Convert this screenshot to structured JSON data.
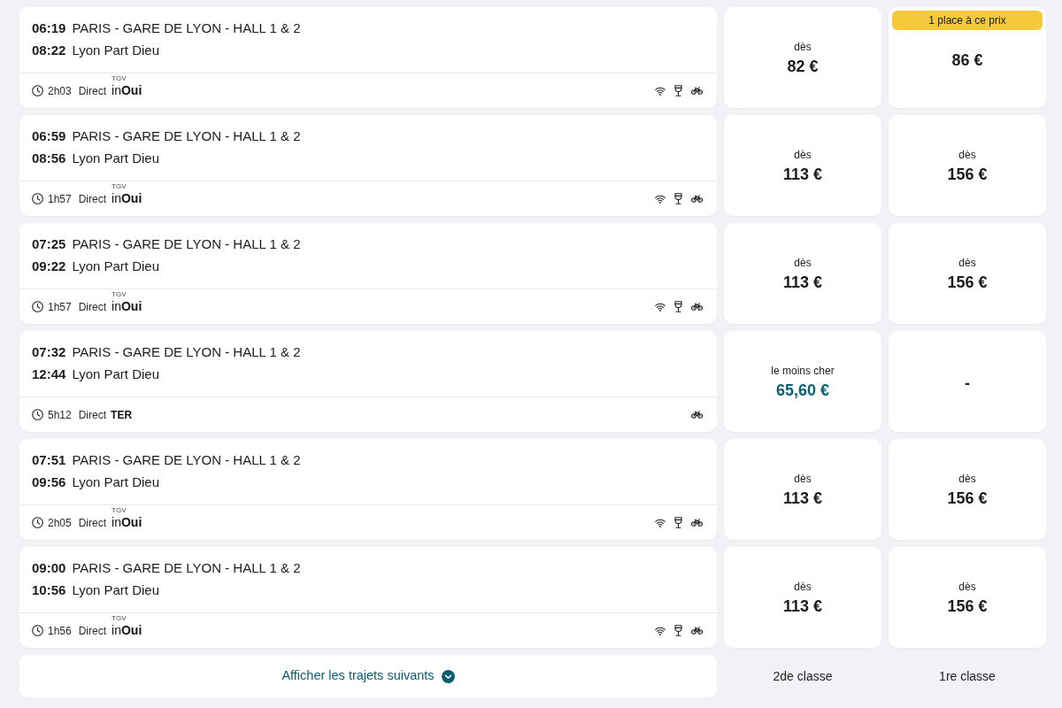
{
  "journeys": [
    {
      "departure_time": "06:19",
      "departure_station": "PARIS - GARE DE LYON - HALL 1 & 2",
      "arrival_time": "08:22",
      "arrival_station": "Lyon Part Dieu",
      "duration": "2h03",
      "service": "Direct",
      "operator": {
        "kind": "inoui",
        "sup": "TGV",
        "name": "in**Oui**"
      },
      "amenities": {
        "wifi": true,
        "bar": true,
        "bike": true
      },
      "second_class": {
        "kind": "from",
        "label": "dès",
        "price": "82 €"
      },
      "first_class": {
        "kind": "from",
        "badge": "1 place à ce prix",
        "price": "86 €"
      }
    },
    {
      "departure_time": "06:59",
      "departure_station": "PARIS - GARE DE LYON - HALL 1 & 2",
      "arrival_time": "08:56",
      "arrival_station": "Lyon Part Dieu",
      "duration": "1h57",
      "service": "Direct",
      "operator": {
        "kind": "inoui",
        "sup": "TGV",
        "name": "in**Oui**"
      },
      "amenities": {
        "wifi": true,
        "bar": true,
        "bike": true
      },
      "second_class": {
        "kind": "from",
        "label": "dès",
        "price": "113 €"
      },
      "first_class": {
        "kind": "from",
        "label": "dès",
        "price": "156 €"
      }
    },
    {
      "departure_time": "07:25",
      "departure_station": "PARIS - GARE DE LYON - HALL 1 & 2",
      "arrival_time": "09:22",
      "arrival_station": "Lyon Part Dieu",
      "duration": "1h57",
      "service": "Direct",
      "operator": {
        "kind": "inoui",
        "sup": "TGV",
        "name": "in**Oui**"
      },
      "amenities": {
        "wifi": true,
        "bar": true,
        "bike": true
      },
      "second_class": {
        "kind": "from",
        "label": "dès",
        "price": "113 €"
      },
      "first_class": {
        "kind": "from",
        "label": "dès",
        "price": "156 €"
      }
    },
    {
      "departure_time": "07:32",
      "departure_station": "PARIS - GARE DE LYON - HALL 1 & 2",
      "arrival_time": "12:44",
      "arrival_station": "Lyon Part Dieu",
      "duration": "5h12",
      "service": "Direct",
      "operator": {
        "kind": "ter",
        "name": "TER"
      },
      "amenities": {
        "wifi": false,
        "bar": false,
        "bike": true
      },
      "second_class": {
        "kind": "cheapest",
        "label": "le moins cher",
        "price": "65,60 €"
      },
      "first_class": {
        "kind": "none",
        "price": "-"
      }
    },
    {
      "departure_time": "07:51",
      "departure_station": "PARIS - GARE DE LYON - HALL 1 & 2",
      "arrival_time": "09:56",
      "arrival_station": "Lyon Part Dieu",
      "duration": "2h05",
      "service": "Direct",
      "operator": {
        "kind": "inoui",
        "sup": "TGV",
        "name": "in**Oui**"
      },
      "amenities": {
        "wifi": true,
        "bar": true,
        "bike": true
      },
      "second_class": {
        "kind": "from",
        "label": "dès",
        "price": "113 €"
      },
      "first_class": {
        "kind": "from",
        "label": "dès",
        "price": "156 €"
      }
    },
    {
      "departure_time": "09:00",
      "departure_station": "PARIS - GARE DE LYON - HALL 1 & 2",
      "arrival_time": "10:56",
      "arrival_station": "Lyon Part Dieu",
      "duration": "1h56",
      "service": "Direct",
      "operator": {
        "kind": "inoui",
        "sup": "TGV",
        "name": "in**Oui**"
      },
      "amenities": {
        "wifi": true,
        "bar": true,
        "bike": true
      },
      "second_class": {
        "kind": "from",
        "label": "dès",
        "price": "113 €"
      },
      "first_class": {
        "kind": "from",
        "label": "dès",
        "price": "156 €"
      }
    }
  ],
  "more_button": {
    "label": "Afficher les trajets suivants"
  },
  "class_labels": [
    "2de classe",
    "1re classe"
  ]
}
